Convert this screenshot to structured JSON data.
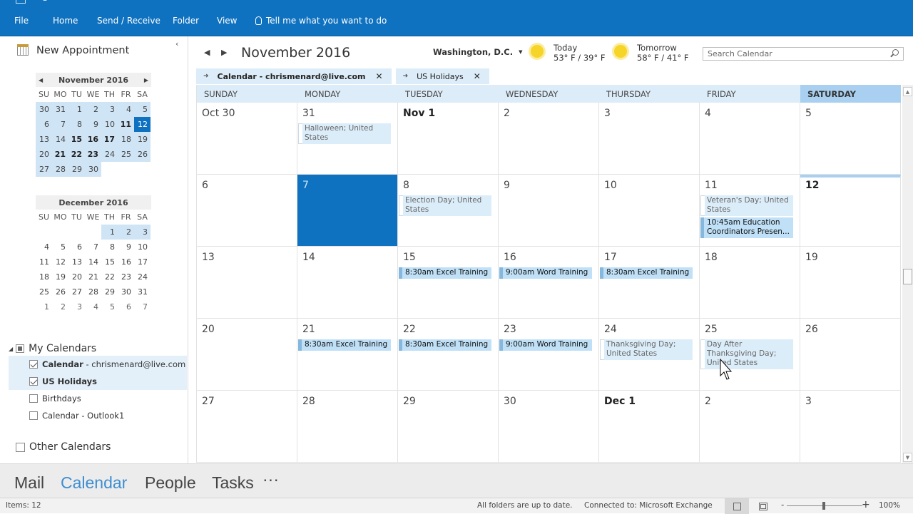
{
  "ribbon": {
    "menu": [
      {
        "label": "File"
      },
      {
        "label": "Home"
      },
      {
        "label": "Send / Receive"
      },
      {
        "label": "Folder"
      },
      {
        "label": "View"
      }
    ],
    "tell_me": "Tell me what you want to do"
  },
  "left": {
    "new_appointment": "New Appointment",
    "minical_nov": {
      "title": "November 2016",
      "dow": [
        "SU",
        "MO",
        "TU",
        "WE",
        "TH",
        "FR",
        "SA"
      ],
      "weeks": [
        [
          "30",
          "31",
          "1",
          "2",
          "3",
          "4",
          "5"
        ],
        [
          "6",
          "7",
          "8",
          "9",
          "10",
          "11",
          "12"
        ],
        [
          "13",
          "14",
          "15",
          "16",
          "17",
          "18",
          "19"
        ],
        [
          "20",
          "21",
          "22",
          "23",
          "24",
          "25",
          "26"
        ],
        [
          "27",
          "28",
          "29",
          "30",
          "",
          "",
          ""
        ]
      ],
      "bold_days": [
        "11",
        "15",
        "16",
        "17",
        "21",
        "22",
        "23"
      ],
      "today": "12"
    },
    "minical_dec": {
      "title": "December 2016",
      "dow": [
        "SU",
        "MO",
        "TU",
        "WE",
        "TH",
        "FR",
        "SA"
      ],
      "weeks": [
        [
          "",
          "",
          "",
          "",
          "1",
          "2",
          "3"
        ],
        [
          "4",
          "5",
          "6",
          "7",
          "8",
          "9",
          "10"
        ],
        [
          "11",
          "12",
          "13",
          "14",
          "15",
          "16",
          "17"
        ],
        [
          "18",
          "19",
          "20",
          "21",
          "22",
          "23",
          "24"
        ],
        [
          "25",
          "26",
          "27",
          "28",
          "29",
          "30",
          "31"
        ],
        [
          "1",
          "2",
          "3",
          "4",
          "5",
          "6",
          "7"
        ]
      ]
    },
    "my_calendars": {
      "title": "My Calendars",
      "items": [
        {
          "name": "Calendar",
          "suffix": " - chrismenard@live.com",
          "checked": true
        },
        {
          "name": "US Holidays",
          "suffix": "",
          "checked": true
        },
        {
          "name": "Birthdays",
          "suffix": "",
          "checked": false
        },
        {
          "name": "Calendar",
          "suffix": " - Outlook1",
          "checked": false
        }
      ]
    },
    "other_calendars": "Other Calendars"
  },
  "main": {
    "month_title": "November 2016",
    "location": "Washington, D.C.",
    "weather": [
      {
        "label": "Today",
        "temps": "53° F / 39° F"
      },
      {
        "label": "Tomorrow",
        "temps": "58° F / 41° F"
      }
    ],
    "search_placeholder": "Search Calendar",
    "tabs": [
      {
        "label": "Calendar - chrismenard@live.com"
      },
      {
        "label": "US Holidays"
      }
    ],
    "dow": [
      "Sunday",
      "Monday",
      "Tuesday",
      "Wednesday",
      "Thursday",
      "Friday",
      "Saturday"
    ],
    "weeks": [
      [
        {
          "d": "Oct 30"
        },
        {
          "d": "31",
          "events": [
            {
              "type": "hol",
              "text": "Halloween; United States"
            }
          ]
        },
        {
          "d": "Nov 1",
          "bold": true
        },
        {
          "d": "2"
        },
        {
          "d": "3"
        },
        {
          "d": "4"
        },
        {
          "d": "5"
        }
      ],
      [
        {
          "d": "6"
        },
        {
          "d": "7",
          "selected": true
        },
        {
          "d": "8",
          "events": [
            {
              "type": "hol",
              "text": "Election Day; United States"
            }
          ]
        },
        {
          "d": "9"
        },
        {
          "d": "10"
        },
        {
          "d": "11",
          "events": [
            {
              "type": "hol",
              "text": "Veteran's Day; United States"
            },
            {
              "type": "appt",
              "text": "10:45am Education Coordinators Presen..."
            }
          ]
        },
        {
          "d": "12",
          "bold": true,
          "today": true
        }
      ],
      [
        {
          "d": "13"
        },
        {
          "d": "14"
        },
        {
          "d": "15",
          "events": [
            {
              "type": "appt",
              "text": "8:30am Excel Training"
            }
          ]
        },
        {
          "d": "16",
          "events": [
            {
              "type": "appt",
              "text": "9:00am Word Training"
            }
          ]
        },
        {
          "d": "17",
          "events": [
            {
              "type": "appt",
              "text": "8:30am Excel Training"
            }
          ]
        },
        {
          "d": "18"
        },
        {
          "d": "19"
        }
      ],
      [
        {
          "d": "20"
        },
        {
          "d": "21",
          "events": [
            {
              "type": "appt",
              "text": "8:30am Excel Training"
            }
          ]
        },
        {
          "d": "22",
          "events": [
            {
              "type": "appt",
              "text": "8:30am Excel Training"
            }
          ]
        },
        {
          "d": "23",
          "events": [
            {
              "type": "appt",
              "text": "9:00am Word Training"
            }
          ]
        },
        {
          "d": "24",
          "events": [
            {
              "type": "hol",
              "text": "Thanksgiving Day; United States"
            }
          ]
        },
        {
          "d": "25",
          "events": [
            {
              "type": "hol",
              "text": "Day After Thanksgiving Day; United States"
            }
          ]
        },
        {
          "d": "26"
        }
      ],
      [
        {
          "d": "27"
        },
        {
          "d": "28"
        },
        {
          "d": "29"
        },
        {
          "d": "30"
        },
        {
          "d": "Dec 1",
          "bold": true
        },
        {
          "d": "2"
        },
        {
          "d": "3"
        }
      ]
    ]
  },
  "bottom_nav": [
    {
      "label": "Mail"
    },
    {
      "label": "Calendar",
      "active": true
    },
    {
      "label": "People"
    },
    {
      "label": "Tasks"
    },
    {
      "label": "···"
    }
  ],
  "status": {
    "items": "Items: 12",
    "sync": "All folders are up to date.",
    "connection": "Connected to: Microsoft Exchange",
    "zoom": "100%",
    "zoom_minus": "-",
    "zoom_plus": "+"
  },
  "colors": {
    "accent": "#0f72c0",
    "header": "#dcecf8",
    "saturday": "#a9d0f0"
  }
}
